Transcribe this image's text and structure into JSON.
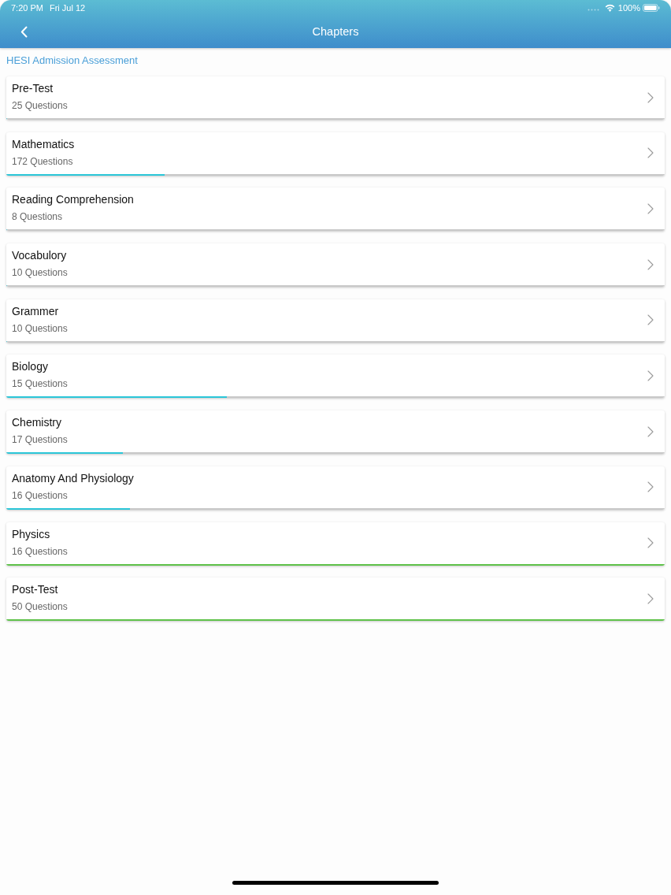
{
  "status_bar": {
    "time": "7:20 PM",
    "date": "Fri Jul 12",
    "battery": "100%"
  },
  "nav_bar": {
    "title": "Chapters"
  },
  "section_title": "HESI Admission Assessment",
  "chapters": [
    {
      "title": "Pre-Test",
      "count": "25 Questions",
      "level": 0
    },
    {
      "title": "Mathematics",
      "count": "172 Questions",
      "level": 0.24
    },
    {
      "title": "Reading Comprehension",
      "count": "8 Questions",
      "level": 0
    },
    {
      "title": "Vocabulory",
      "count": "10 Questions",
      "level": 0
    },
    {
      "title": "Grammer",
      "count": "10 Questions",
      "level": 0
    },
    {
      "title": "Biology",
      "count": "15 Questions",
      "level": 0.335
    },
    {
      "title": "Chemistry",
      "count": "17 Questions",
      "level": 0.177
    },
    {
      "title": "Anatomy And Physiology",
      "count": "16 Questions",
      "level": 0.188
    },
    {
      "title": "Physics",
      "count": "16 Questions",
      "level": 1
    },
    {
      "title": "Post-Test",
      "count": "50 Questions",
      "level": 1
    }
  ]
}
